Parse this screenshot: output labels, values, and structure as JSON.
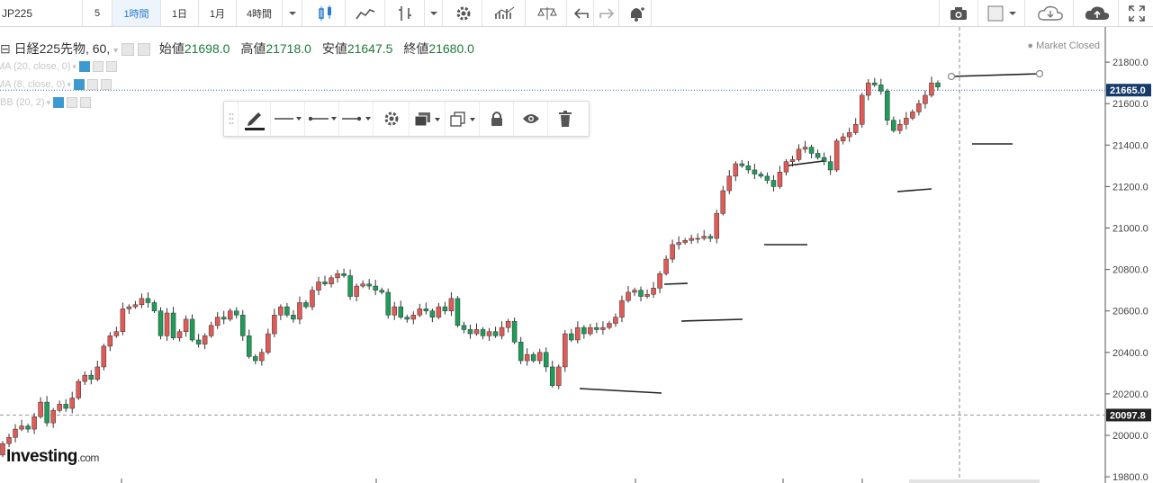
{
  "toolbar": {
    "symbol": "JP225",
    "intervals": [
      "5",
      "1時間",
      "1日",
      "1月",
      "4時間"
    ],
    "active_interval": "1時間"
  },
  "legend": {
    "title": "日経225先物, 60,",
    "open_label": "始値",
    "open": "21698.0",
    "high_label": "高値",
    "high": "21718.0",
    "low_label": "安値",
    "low": "21647.5",
    "close_label": "終値",
    "close": "21680.0"
  },
  "indicators": [
    "MA (20, close, 0)",
    "MA (8, close, 0)",
    "BB (20, 2)"
  ],
  "market_status": "Market Closed",
  "logo": {
    "main": "Investing",
    "suffix": ".com"
  },
  "colors": {
    "up": "#e05b56",
    "down": "#1f9c5a",
    "price_line": "#2a6db5",
    "price_tag": "#173a6d"
  },
  "chart_data": {
    "type": "candlestick",
    "ylim": [
      19800,
      21900
    ],
    "y_ticks": [
      19800,
      20000,
      20200,
      20400,
      20600,
      20800,
      21000,
      21200,
      21400,
      21600,
      21800
    ],
    "current_price": "21665.0",
    "marked_price": "20097.8",
    "grid": false,
    "closes": [
      19960,
      19990,
      20030,
      20045,
      20030,
      20090,
      20160,
      20060,
      20120,
      20150,
      20130,
      20180,
      20260,
      20290,
      20270,
      20330,
      20430,
      20480,
      20500,
      20610,
      20620,
      20630,
      20660,
      20640,
      20600,
      20480,
      20590,
      20470,
      20500,
      20560,
      20460,
      20440,
      20480,
      20530,
      20570,
      20560,
      20600,
      20580,
      20480,
      20380,
      20360,
      20400,
      20490,
      20580,
      20620,
      20580,
      20560,
      20640,
      20620,
      20700,
      20740,
      20730,
      20760,
      20780,
      20770,
      20670,
      20720,
      20730,
      20720,
      20700,
      20690,
      20580,
      20620,
      20570,
      20560,
      20580,
      20610,
      20600,
      20570,
      20620,
      20600,
      20660,
      20530,
      20510,
      20490,
      20510,
      20480,
      20500,
      20480,
      20520,
      20550,
      20450,
      20360,
      20390,
      20360,
      20400,
      20330,
      20240,
      20330,
      20490,
      20460,
      20520,
      20490,
      20520,
      20510,
      20520,
      20540,
      20570,
      20650,
      20690,
      20700,
      20670,
      20680,
      20710,
      20780,
      20850,
      20920,
      20930,
      20940,
      20950,
      20950,
      20960,
      20950,
      21070,
      21180,
      21250,
      21310,
      21300,
      21280,
      21260,
      21250,
      21230,
      21200,
      21270,
      21320,
      21330,
      21380,
      21390,
      21360,
      21340,
      21320,
      21280,
      21420,
      21440,
      21460,
      21500,
      21640,
      21700,
      21690,
      21660,
      21520,
      21470,
      21500,
      21530,
      21560,
      21600,
      21640,
      21700,
      21680
    ]
  }
}
